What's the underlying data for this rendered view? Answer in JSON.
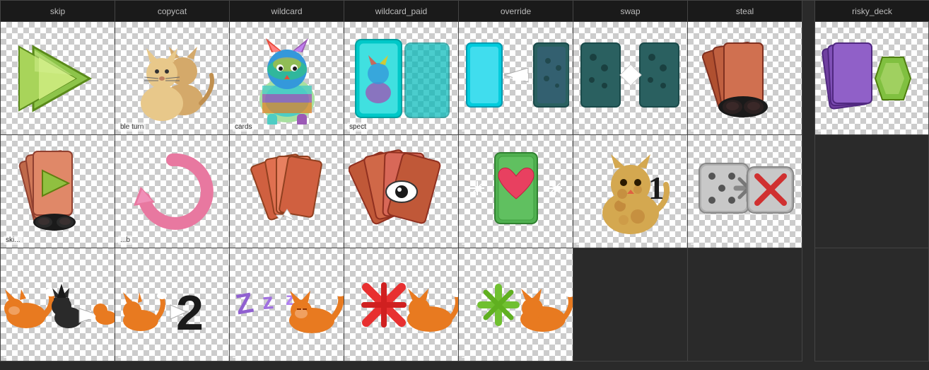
{
  "columns": [
    {
      "id": "skip",
      "label": "skip"
    },
    {
      "id": "copycat",
      "label": "copycat"
    },
    {
      "id": "wildcard",
      "label": "wildcard"
    },
    {
      "id": "wildcard_paid",
      "label": "wildcard_paid"
    },
    {
      "id": "override",
      "label": "override"
    },
    {
      "id": "swap",
      "label": "swap"
    },
    {
      "id": "steal",
      "label": "steal"
    },
    {
      "id": "risky_deck",
      "label": "risky_deck"
    }
  ],
  "rows": [
    {
      "cells": [
        {
          "col": "skip",
          "sublabel": ""
        },
        {
          "col": "copycat",
          "sublabel": "ble turn"
        },
        {
          "col": "wildcard",
          "sublabel": "cards"
        },
        {
          "col": "wildcard_paid",
          "sublabel": "spect"
        },
        {
          "col": "override",
          "sublabel": ""
        },
        {
          "col": "swap",
          "sublabel": ""
        },
        {
          "col": "steal",
          "sublabel": ""
        },
        {
          "col": "risky_deck",
          "sublabel": ""
        }
      ]
    },
    {
      "cells": [
        {
          "col": "skip",
          "sublabel": "ski..."
        },
        {
          "col": "copycat",
          "sublabel": "...b"
        },
        {
          "col": "wildcard",
          "sublabel": ""
        },
        {
          "col": "wildcard_paid",
          "sublabel": ""
        },
        {
          "col": "override",
          "sublabel": ""
        },
        {
          "col": "swap",
          "sublabel": ""
        },
        {
          "col": "steal",
          "sublabel": ""
        },
        {
          "col": "risky_deck",
          "sublabel": ""
        }
      ]
    },
    {
      "cells": [
        {
          "col": "skip",
          "sublabel": ""
        },
        {
          "col": "copycat",
          "sublabel": ""
        },
        {
          "col": "wildcard",
          "sublabel": ""
        },
        {
          "col": "wildcard_paid",
          "sublabel": ""
        },
        {
          "col": "override",
          "sublabel": ""
        },
        {
          "col": "swap",
          "sublabel": ""
        },
        {
          "col": "steal",
          "sublabel": ""
        },
        {
          "col": "risky_deck",
          "sublabel": ""
        }
      ]
    }
  ]
}
